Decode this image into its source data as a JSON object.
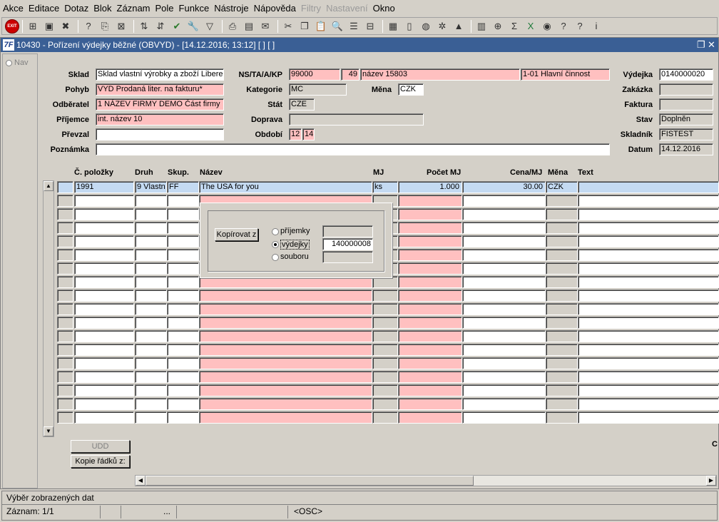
{
  "menu": [
    "Akce",
    "Editace",
    "Dotaz",
    "Blok",
    "Záznam",
    "Pole",
    "Funkce",
    "Nástroje",
    "Nápověda",
    "Filtry",
    "Nastavení",
    "Okno"
  ],
  "menu_disabled": [
    "Filtry",
    "Nastavení"
  ],
  "toolbar": {
    "exit_label": "EXIT"
  },
  "window": {
    "title": "10430 - Pořízení výdejky běžné (OBVYD) - [14.12.2016; 13:12]  [ ]  [ ]",
    "logo": "7F",
    "restore_glyph": "❐",
    "close_glyph": "✕"
  },
  "nav": {
    "label": "Nav"
  },
  "form": {
    "sklad_label": "Sklad",
    "sklad": "Sklad vlastní výrobky a zboží Liberec",
    "pohyb_label": "Pohyb",
    "pohyb": "VYD Prodaná liter. na fakturu*",
    "odberatel_label": "Odběratel",
    "odberatel": "1 NÁZEV FIRMY DEMO Část firmy",
    "prijemce_label": "Příjemce",
    "prijemce": "int. název 10",
    "prevzal_label": "Převzal",
    "prevzal": "",
    "poznamka_label": "Poznámka",
    "poznamka": "",
    "ns_label": "NS/TA/A/KP",
    "ns": "99000",
    "ta": "49",
    "a": "název 15803",
    "kp": "1-01 Hlavní činnost",
    "kategorie_label": "Kategorie",
    "kategorie": "MC",
    "mena_label": "Měna",
    "mena": "CZK",
    "stat_label": "Stát",
    "stat": "CZE",
    "doprava_label": "Doprava",
    "doprava": "",
    "obdobi_label": "Období",
    "obdobi_m": "12",
    "obdobi_r": "14",
    "vydejka_label": "Výdejka",
    "vydejka": "0140000020",
    "zakazka_label": "Zakázka",
    "zakazka": "",
    "faktura_label": "Faktura",
    "faktura": "",
    "stav_label": "Stav",
    "stav": "Doplněn",
    "skladnik_label": "Skladník",
    "skladnik": "FISTEST",
    "datum_label": "Datum",
    "datum": "14.12.2016"
  },
  "table": {
    "headers": [
      "Č. položky",
      "Druh",
      "Skup.",
      "Název",
      "MJ",
      "Počet MJ",
      "Cena/MJ",
      "Měna",
      "Text"
    ],
    "rows": [
      [
        "1991",
        "9 Vlastn",
        "FF",
        "The USA for you",
        "ks",
        "1.000",
        "30.00",
        "CZK",
        ""
      ]
    ]
  },
  "dialog": {
    "button": "Kopírovat z",
    "options": [
      "příjemky",
      "výdejky",
      "souboru"
    ],
    "selected": 1,
    "values": [
      "",
      "140000008",
      ""
    ]
  },
  "buttons": {
    "udd": "UDD",
    "kopie": "Kopie řádků z:"
  },
  "right_cut": "C",
  "status": {
    "line1": "Výběr zobrazených dat",
    "line2_record": "Záznam: 1/1",
    "line2_dots": "...",
    "line2_osc": "<OSC>"
  }
}
